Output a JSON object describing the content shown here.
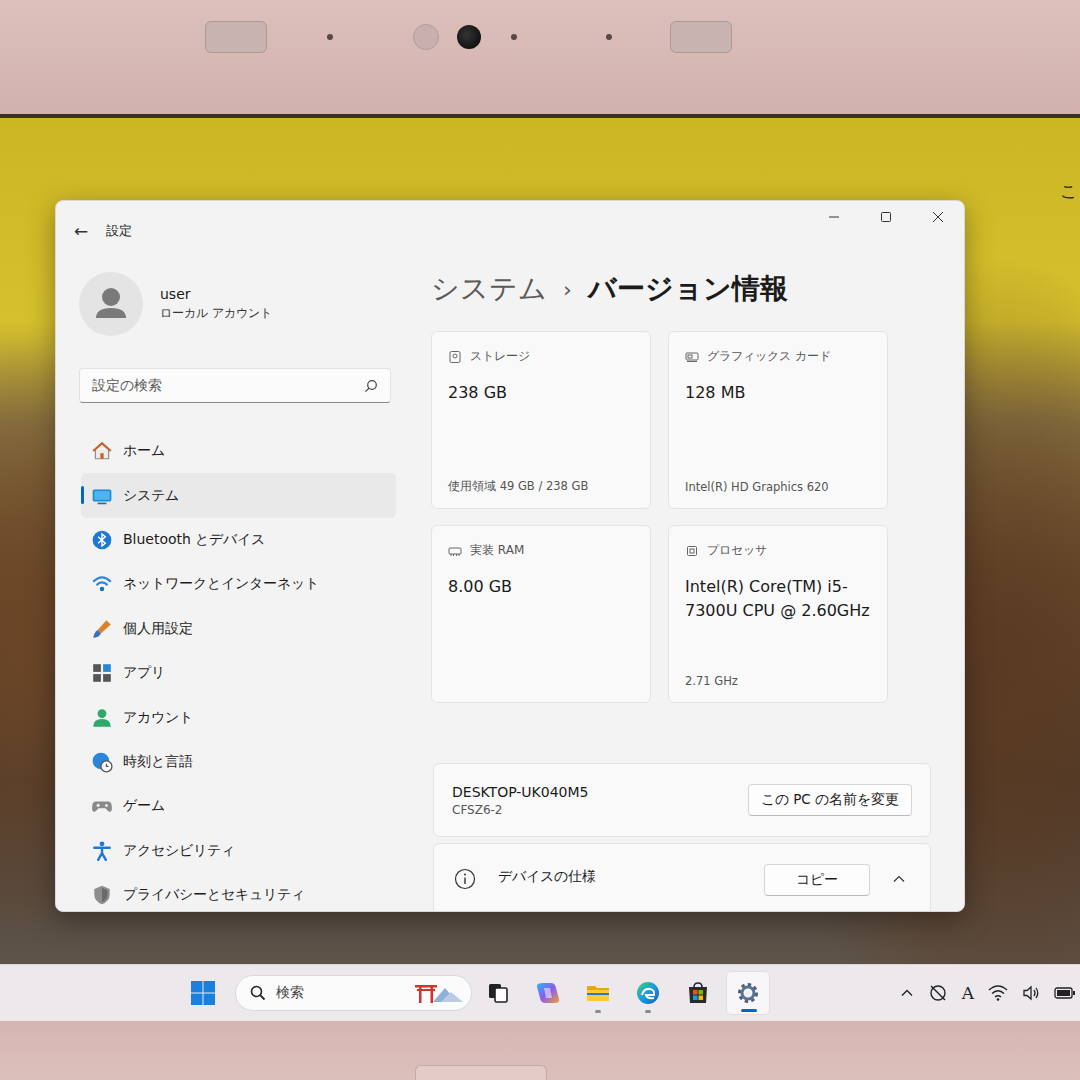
{
  "window": {
    "title": "設定",
    "back": "←"
  },
  "account": {
    "name": "user",
    "type": "ローカル アカウント"
  },
  "search": {
    "placeholder": "設定の検索"
  },
  "sidebar": {
    "items": [
      {
        "label": "ホーム",
        "selected": false
      },
      {
        "label": "システム",
        "selected": true
      },
      {
        "label": "Bluetooth とデバイス",
        "selected": false
      },
      {
        "label": "ネットワークとインターネット",
        "selected": false
      },
      {
        "label": "個人用設定",
        "selected": false
      },
      {
        "label": "アプリ",
        "selected": false
      },
      {
        "label": "アカウント",
        "selected": false
      },
      {
        "label": "時刻と言語",
        "selected": false
      },
      {
        "label": "ゲーム",
        "selected": false
      },
      {
        "label": "アクセシビリティ",
        "selected": false
      },
      {
        "label": "プライバシーとセキュリティ",
        "selected": false
      }
    ]
  },
  "breadcrumb": {
    "parent": "システム",
    "separator": "›",
    "current": "バージョン情報"
  },
  "cards": [
    {
      "label": "ストレージ",
      "value": "238 GB",
      "detail": "使用領域 49 GB / 238 GB"
    },
    {
      "label": "グラフィックス カード",
      "value": "128 MB",
      "detail": "Intel(R) HD Graphics 620"
    },
    {
      "label": "実装 RAM",
      "value": "8.00 GB",
      "detail": ""
    },
    {
      "label": "プロセッサ",
      "value": "Intel(R) Core(TM) i5-7300U CPU @ 2.60GHz",
      "detail": "2.71 GHz"
    }
  ],
  "device": {
    "name": "DESKTOP-UK040M5",
    "model": "CFSZ6-2",
    "rename_button": "この PC の名前を変更"
  },
  "specs": {
    "title": "デバイスの仕様",
    "copy_button": "コピー",
    "expanded": true
  },
  "taskbar": {
    "search_placeholder": "検索",
    "ime": "A",
    "apps": [
      {
        "running": false,
        "active": false
      },
      {
        "running": false,
        "active": false
      },
      {
        "running": true,
        "active": false
      },
      {
        "running": true,
        "active": false
      },
      {
        "running": false,
        "active": false
      },
      {
        "running": true,
        "active": true
      }
    ]
  },
  "desktop": {
    "edge_text": "こ"
  }
}
